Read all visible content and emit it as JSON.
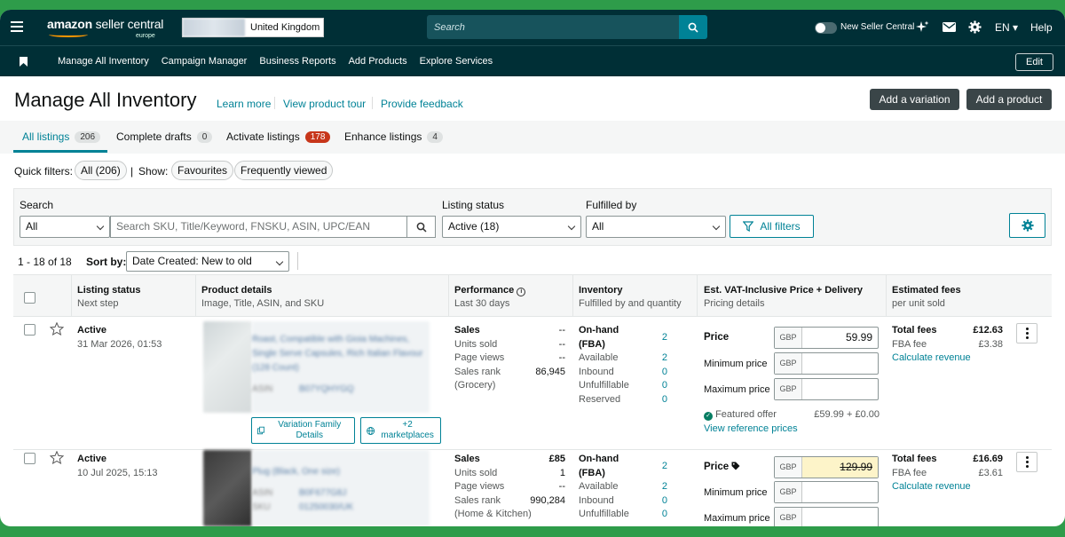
{
  "topbar": {
    "logo_main": "amazon",
    "logo_rest": " seller central",
    "logo_region": "europe",
    "store_name": "Brew Italia",
    "store_country": "United Kingdom",
    "search_placeholder": "Search",
    "new_seller_central": "New Seller Central",
    "language": "EN",
    "help": "Help"
  },
  "nav": {
    "items": [
      "Manage All Inventory",
      "Campaign Manager",
      "Business Reports",
      "Add Products",
      "Explore Services"
    ],
    "edit": "Edit"
  },
  "page": {
    "title": "Manage All Inventory",
    "learn_more": "Learn more",
    "product_tour": "View product tour",
    "feedback": "Provide feedback",
    "add_variation": "Add a variation",
    "add_product": "Add a product"
  },
  "tabs": [
    {
      "label": "All listings",
      "count": "206"
    },
    {
      "label": "Complete drafts",
      "count": "0"
    },
    {
      "label": "Activate listings",
      "count": "178"
    },
    {
      "label": "Enhance listings",
      "count": "4"
    }
  ],
  "quick_filters": {
    "label": "Quick filters:",
    "all": "All (206)",
    "divider": "|",
    "show": "Show:",
    "favourites": "Favourites",
    "frequently_viewed": "Frequently viewed"
  },
  "search_panel": {
    "search_label": "Search",
    "search_scope": "All",
    "search_placeholder": "Search SKU, Title/Keyword, FNSKU, ASIN, UPC/EAN",
    "status_label": "Listing status",
    "status_value": "Active (18)",
    "fulfilled_label": "Fulfilled by",
    "fulfilled_value": "All",
    "all_filters": "All filters"
  },
  "results": {
    "range": "1 - 18 of 18",
    "sort_label": "Sort by:",
    "sort_value": "Date Created: New to old"
  },
  "columns": [
    {
      "title": "Listing status",
      "sub": "Next step"
    },
    {
      "title": "Product details",
      "sub": "Image, Title, ASIN, and SKU"
    },
    {
      "title": "Performance",
      "sub": "Last 30 days"
    },
    {
      "title": "Inventory",
      "sub": "Fulfilled by and quantity"
    },
    {
      "title": "Est. VAT-Inclusive Price + Delivery",
      "sub": "Pricing details"
    },
    {
      "title": "Estimated fees",
      "sub": "per unit sold"
    }
  ],
  "rows": [
    {
      "status": "Active",
      "date": "31 Mar 2026, 01:53",
      "title_blur": "Roast, Compatible with Gioia Machines, Single Serve Capsules, Rich Italian Flavour (128 Count)",
      "asin_label": "ASIN",
      "asin_blur": "B07YQHYGQ",
      "variation_btn": "Variation Family Details",
      "marketplaces_btn": "+2 marketplaces",
      "perf": {
        "sales_label": "Sales",
        "sales": "--",
        "units_label": "Units sold",
        "units": "--",
        "views_label": "Page views",
        "views": "--",
        "rank_label": "Sales rank",
        "rank": "86,945",
        "category": "(Grocery)"
      },
      "inv": {
        "onhand_label": "On-hand",
        "fba": "(FBA)",
        "onhand": "2",
        "available_label": "Available",
        "available": "2",
        "inbound_label": "Inbound",
        "inbound": "0",
        "unfulfillable_label": "Unfulfillable",
        "unfulfillable": "0",
        "reserved_label": "Reserved",
        "reserved": "0"
      },
      "price": {
        "label": "Price",
        "currency": "GBP",
        "value": "59.99",
        "min_label": "Minimum price",
        "max_label": "Maximum price",
        "featured": "Featured offer",
        "featured_value": "£59.99 + £0.00",
        "reference": "View reference prices"
      },
      "fees": {
        "total_label": "Total fees",
        "total": "£12.63",
        "fba_label": "FBA fee",
        "fba": "£3.38",
        "calc": "Calculate revenue"
      }
    },
    {
      "status": "Active",
      "date": "10 Jul 2025, 15:13",
      "title_blur": "Plug (Black, One size)",
      "asin_label": "ASIN",
      "asin_blur": "B0F677G8J",
      "sku_label": "SKU",
      "sku_blur": "01250030/UK",
      "perf": {
        "sales_label": "Sales",
        "sales": "£85",
        "units_label": "Units sold",
        "units": "1",
        "views_label": "Page views",
        "views": "--",
        "rank_label": "Sales rank",
        "rank": "990,284",
        "category": "(Home & Kitchen)"
      },
      "inv": {
        "onhand_label": "On-hand",
        "fba": "(FBA)",
        "onhand": "2",
        "available_label": "Available",
        "available": "2",
        "inbound_label": "Inbound",
        "inbound": "0",
        "unfulfillable_label": "Unfulfillable",
        "unfulfillable": "0"
      },
      "price": {
        "label": "Price",
        "currency": "GBP",
        "value": "129.99",
        "min_label": "Minimum price",
        "max_label": "Maximum price"
      },
      "fees": {
        "total_label": "Total fees",
        "total": "£16.69",
        "fba_label": "FBA fee",
        "fba": "£3.61",
        "calc": "Calculate revenue"
      }
    }
  ]
}
